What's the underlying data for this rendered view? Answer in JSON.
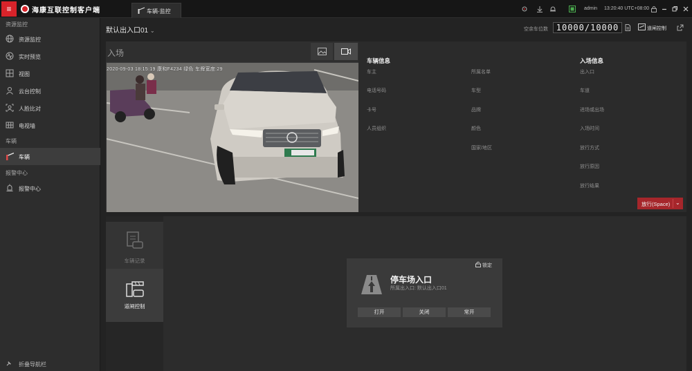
{
  "titlebar": {
    "app_title": "海康互联控制客户端",
    "active_tab": "车辆-监控",
    "user": "admin",
    "clock": "13:20:40 UTC+08:00",
    "menu_glyph": "≡"
  },
  "sidebar": {
    "sections": [
      {
        "label": "资源监控"
      },
      {
        "label": "车辆"
      },
      {
        "label": "报警中心"
      }
    ],
    "items": [
      {
        "label": "资源监控",
        "icon": "globe-icon"
      },
      {
        "label": "实时预览",
        "icon": "wave-icon"
      },
      {
        "label": "视图",
        "icon": "grid-view-icon"
      },
      {
        "label": "云台控制",
        "icon": "person-icon"
      },
      {
        "label": "人脸比对",
        "icon": "face-compare-icon"
      },
      {
        "label": "电视墙",
        "icon": "tv-wall-icon"
      },
      {
        "label": "车辆",
        "icon": "barrier-gate-icon"
      },
      {
        "label": "报警中心",
        "icon": "alarm-bell-icon"
      }
    ],
    "collapse_label": "折叠导航栏"
  },
  "header": {
    "entrance": "默认出入口01",
    "spots_label": "空余车位数",
    "spots_value": "10000/10000",
    "barrier_control": "道闸控制"
  },
  "video": {
    "title": "入场",
    "osd": "2020-09-03 18:15:19 康和F4234 绿色 车牌宽度:29"
  },
  "vehicle_info": {
    "title": "车辆信息",
    "left_fields": [
      "车主",
      "电话号码",
      "卡号",
      "人员组织"
    ],
    "mid_fields": [
      "所属名单",
      "车型",
      "品牌",
      "颜色",
      "国家/地区"
    ]
  },
  "entry_info": {
    "title": "入场信息",
    "fields": [
      "出入口",
      "车道",
      "进场或出场",
      "入场时间",
      "放行方式",
      "放行原因",
      "放行结果"
    ]
  },
  "release_button": "放行(Space)",
  "bottom_tabs": {
    "records": "车辆记录",
    "gate": "道闸控制"
  },
  "gate_card": {
    "lock": "锁定",
    "name": "停车场入口",
    "subtitle": "所属出入口: 默认出入口01",
    "buttons": [
      "打开",
      "关闭",
      "常开"
    ]
  },
  "colors": {
    "accent_red": "#d8232a",
    "release_red": "#a6262b",
    "background": "#232323",
    "sidebar": "#2d2d2d"
  }
}
